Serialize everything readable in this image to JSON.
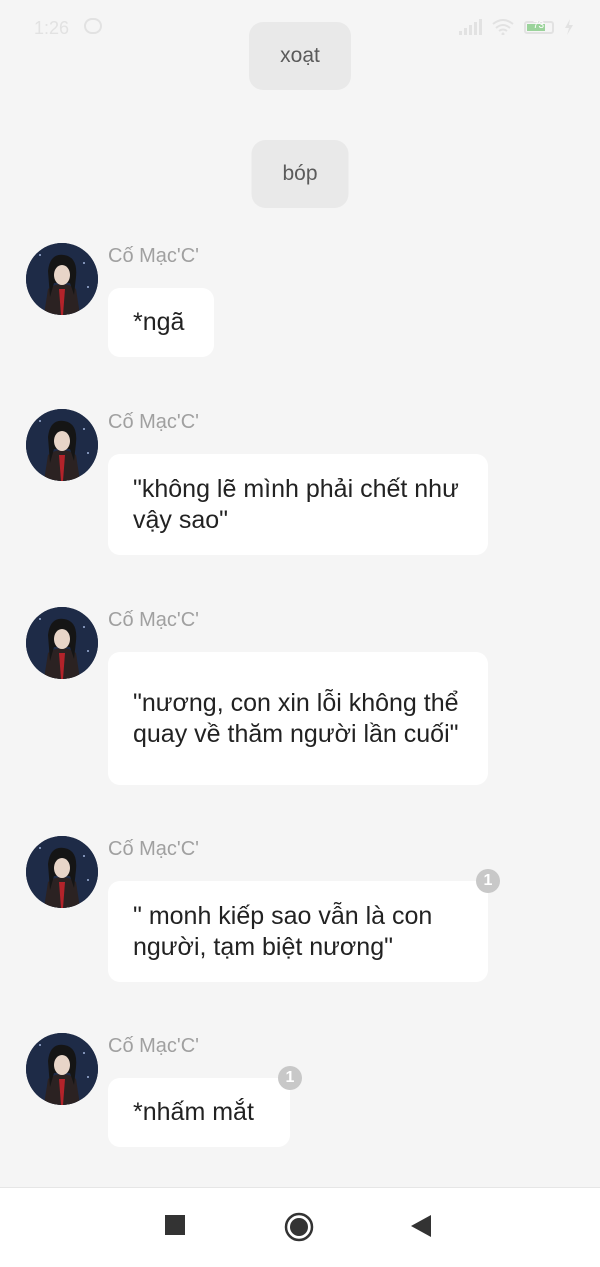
{
  "status_bar": {
    "time": "1:26",
    "battery": "73"
  },
  "self_messages": [
    {
      "text": "xoạt"
    },
    {
      "text": "bóp"
    }
  ],
  "messages": [
    {
      "sender": "Cố Mạc'C'",
      "text": "*ngã",
      "badge": ""
    },
    {
      "sender": "Cố Mạc'C'",
      "text": "\"không lẽ mình phải chết như vậy sao\"",
      "badge": ""
    },
    {
      "sender": "Cố Mạc'C'",
      "text": "\"nương, con xin lỗi không thể quay về thăm người lần cuối\"",
      "badge": ""
    },
    {
      "sender": "Cố Mạc'C'",
      "text": "\" monh kiếp sao vẫn là con người, tạm biệt nương\"",
      "badge": "1"
    },
    {
      "sender": "Cố Mạc'C'",
      "text": "*nhấm mắt",
      "badge": "1"
    }
  ],
  "nav": {
    "items": [
      "recents-icon",
      "home-icon",
      "back-icon"
    ]
  }
}
